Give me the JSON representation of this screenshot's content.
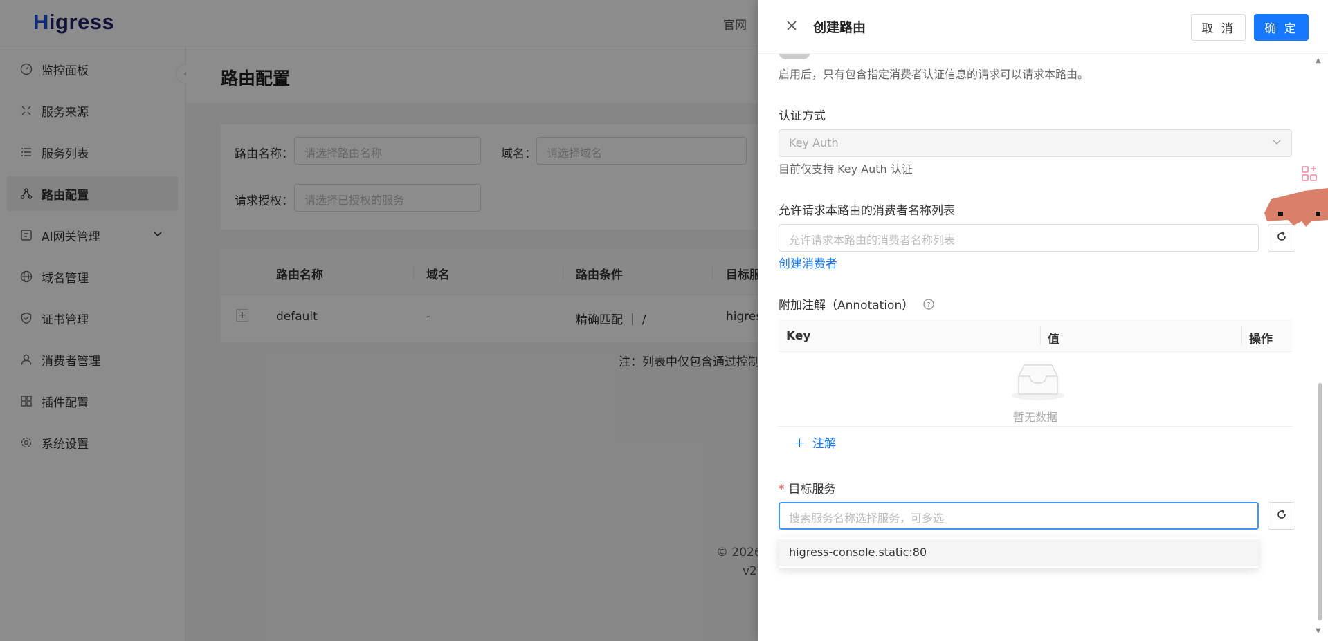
{
  "brand": {
    "logo_h": "H",
    "logo_rest": "igress"
  },
  "header": {
    "official_site": "官网"
  },
  "sidebar": {
    "items": [
      {
        "label": "监控面板",
        "icon": "dashboard-icon"
      },
      {
        "label": "服务来源",
        "icon": "service-source-icon"
      },
      {
        "label": "服务列表",
        "icon": "list-icon"
      },
      {
        "label": "路由配置",
        "icon": "route-icon",
        "active": true
      },
      {
        "label": "AI网关管理",
        "icon": "ai-gateway-icon",
        "expandable": true
      },
      {
        "label": "域名管理",
        "icon": "globe-icon"
      },
      {
        "label": "证书管理",
        "icon": "shield-icon"
      },
      {
        "label": "消费者管理",
        "icon": "user-icon"
      },
      {
        "label": "插件配置",
        "icon": "plugin-icon"
      },
      {
        "label": "系统设置",
        "icon": "gear-icon"
      }
    ]
  },
  "page": {
    "title": "路由配置",
    "filters": {
      "route_name_label": "路由名称：",
      "route_name_placeholder": "请选择路由名称",
      "domain_label": "域名：",
      "domain_placeholder": "请选择域名",
      "auth_label": "请求授权：",
      "auth_placeholder": "请选择已授权的服务"
    },
    "table": {
      "columns": [
        "路由名称",
        "域名",
        "路由条件",
        "目标服"
      ],
      "rows": [
        {
          "name": "default",
          "domain": "-",
          "condition": "精确匹配 ｜ /",
          "target": "higres"
        }
      ]
    },
    "note": "注：列表中仅包含通过控制",
    "footer_copyright": "© 2026",
    "footer_version": "v2."
  },
  "drawer": {
    "title": "创建路由",
    "cancel_label": "取 消",
    "ok_label": "确 定",
    "auth_hint": "启用后，只有包含指定消费者认证信息的请求可以请求本路由。",
    "auth_method_label": "认证方式",
    "auth_method_value": "Key Auth",
    "auth_method_hint": "目前仅支持 Key Auth 认证",
    "consumers_label": "允许请求本路由的消费者名称列表",
    "consumers_placeholder": "允许请求本路由的消费者名称列表",
    "create_consumer_link": "创建消费者",
    "annotation_label": "附加注解（Annotation）",
    "annotation_columns": [
      "Key",
      "值",
      "操作"
    ],
    "annotation_empty": "暂无数据",
    "add_annotation": "注解",
    "target_service_label": "目标服务",
    "target_service_placeholder": "搜索服务名称选择服务，可多选",
    "dropdown_options": [
      "higress-console.static:80"
    ]
  }
}
